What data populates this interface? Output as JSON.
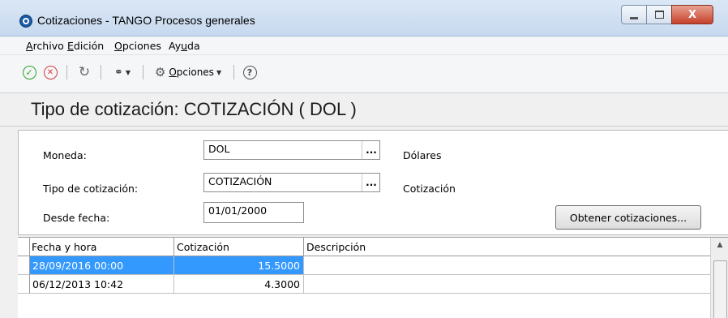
{
  "window": {
    "title": "Cotizaciones - TANGO Procesos generales",
    "controls": {
      "close_glyph": "X"
    }
  },
  "menu": [
    {
      "accel": "A",
      "rest": "rchivo"
    },
    {
      "accel": "E",
      "rest": "dición"
    },
    {
      "accel": "O",
      "rest": "pciones"
    },
    {
      "pre": "Ay",
      "accel": "u",
      "rest": "da"
    }
  ],
  "toolbar": {
    "ok_icon": "check-circle-icon",
    "cancel_icon": "x-circle-icon",
    "refresh_icon": "refresh-icon",
    "find_icon": "binoculars-icon",
    "options_accel": "O",
    "options_rest": "pciones",
    "help_icon": "help-icon"
  },
  "heading": "Tipo de cotización: COTIZACIÓN ( DOL )",
  "form": {
    "moneda_label": "Moneda:",
    "moneda_value": "DOL",
    "moneda_desc": "Dólares",
    "tipo_label": "Tipo de cotización:",
    "tipo_value": "COTIZACIÓN",
    "tipo_desc": "Cotización",
    "desde_label": "Desde fecha:",
    "desde_value": "01/01/2000",
    "ellipsis": "...",
    "obtener_button": "Obtener cotizaciones..."
  },
  "grid": {
    "columns": [
      "Fecha y hora",
      "Cotización",
      "Descripción"
    ],
    "rows": [
      {
        "fecha": "28/09/2016 00:00",
        "cotizacion": "15.5000",
        "descripcion": ""
      },
      {
        "fecha": "06/12/2013 10:42",
        "cotizacion": "4.3000",
        "descripcion": ""
      }
    ]
  },
  "colors": {
    "selection": "#3399ff",
    "title_bar": "#c6d9ef",
    "close_button": "#c6412b"
  }
}
